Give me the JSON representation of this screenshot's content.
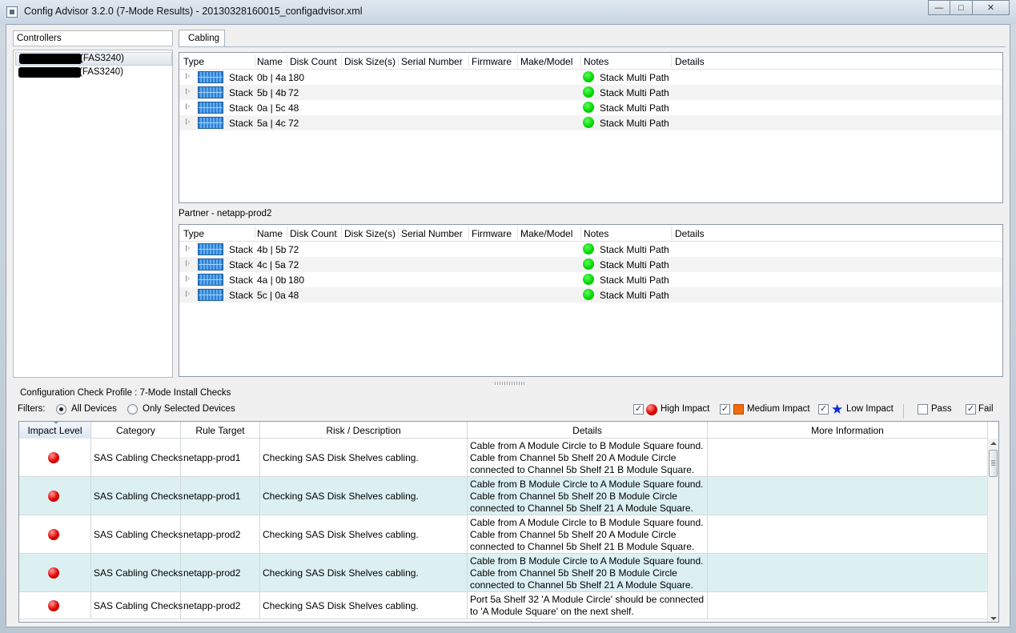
{
  "window": {
    "title": "Config Advisor 3.2.0 (7-Mode Results) - 20130328160015_configadvisor.xml",
    "minimize": "—",
    "maximize": "□",
    "close": "✕"
  },
  "controllers": {
    "header": "Controllers",
    "items": [
      {
        "label": "(FAS3240)",
        "selected": true
      },
      {
        "label": "(FAS3240)",
        "selected": false
      }
    ]
  },
  "tabs": [
    {
      "label": "Cabling"
    }
  ],
  "stack_columns": [
    "Type",
    "Name",
    "Disk Count",
    "Disk Size(s)",
    "Serial Number",
    "Firmware",
    "Make/Model",
    "Notes",
    "Details"
  ],
  "local_stacks": [
    {
      "type": "Stack",
      "name": "0b | 4a",
      "disk_count": "180",
      "notes": "Stack Multi Path"
    },
    {
      "type": "Stack",
      "name": "5b | 4b",
      "disk_count": "72",
      "notes": "Stack Multi Path"
    },
    {
      "type": "Stack",
      "name": "0a | 5c",
      "disk_count": "48",
      "notes": "Stack Multi Path"
    },
    {
      "type": "Stack",
      "name": "5a | 4c",
      "disk_count": "72",
      "notes": "Stack Multi Path"
    }
  ],
  "partner_label": "Partner - netapp-prod2",
  "partner_stacks": [
    {
      "type": "Stack",
      "name": "4b | 5b",
      "disk_count": "72",
      "notes": "Stack Multi Path"
    },
    {
      "type": "Stack",
      "name": "4c | 5a",
      "disk_count": "72",
      "notes": "Stack Multi Path"
    },
    {
      "type": "Stack",
      "name": "4a | 0b",
      "disk_count": "180",
      "notes": "Stack Multi Path"
    },
    {
      "type": "Stack",
      "name": "5c | 0a",
      "disk_count": "48",
      "notes": "Stack Multi Path"
    }
  ],
  "profile": "Configuration Check Profile : 7-Mode Install Checks",
  "filters": {
    "label": "Filters:",
    "all_devices": "All Devices",
    "only_selected": "Only Selected Devices",
    "high_impact": "High Impact",
    "medium_impact": "Medium Impact",
    "low_impact": "Low Impact",
    "pass": "Pass",
    "fail": "Fail",
    "check_mark": "✓",
    "star": "★"
  },
  "results_columns": [
    "Impact Level",
    "Category",
    "Rule Target",
    "Risk / Description",
    "Details",
    "More Information"
  ],
  "results": [
    {
      "category": "SAS Cabling Checks",
      "target": "netapp-prod1",
      "risk": "Checking SAS Disk Shelves cabling.",
      "details": [
        "Cable from A Module Circle to B Module Square found.",
        "Cable from Channel 5b Shelf 20 A Module Circle",
        "connected to Channel 5b Shelf 21 B Module Square."
      ]
    },
    {
      "category": "SAS Cabling Checks",
      "target": "netapp-prod1",
      "risk": "Checking SAS Disk Shelves cabling.",
      "details": [
        "Cable from B Module Circle to A Module Square found.",
        "Cable from Channel 5b Shelf 20 B Module Circle",
        "connected to Channel 5b Shelf 21 A Module Square."
      ]
    },
    {
      "category": "SAS Cabling Checks",
      "target": "netapp-prod2",
      "risk": "Checking SAS Disk Shelves cabling.",
      "details": [
        "Cable from A Module Circle to B Module Square found.",
        "Cable from Channel 5b Shelf 20 A Module Circle",
        "connected to Channel 5b Shelf 21 B Module Square."
      ]
    },
    {
      "category": "SAS Cabling Checks",
      "target": "netapp-prod2",
      "risk": "Checking SAS Disk Shelves cabling.",
      "details": [
        "Cable from B Module Circle to A Module Square found.",
        "Cable from Channel 5b Shelf 20 B Module Circle",
        "connected to Channel 5b Shelf 21 A Module Square."
      ]
    },
    {
      "category": "SAS Cabling Checks",
      "target": "netapp-prod2",
      "risk": "Checking SAS Disk Shelves cabling.",
      "details": [
        "Port 5a Shelf 32 'A Module Circle' should be connected",
        "to 'A Module Square' on the next shelf."
      ]
    }
  ],
  "colors": {
    "high_impact": "#e00000",
    "medium_impact": "#f36b0c",
    "low_impact": "#0b2be0",
    "ok": "#00d400",
    "alt_row": "#dcf0f1"
  }
}
